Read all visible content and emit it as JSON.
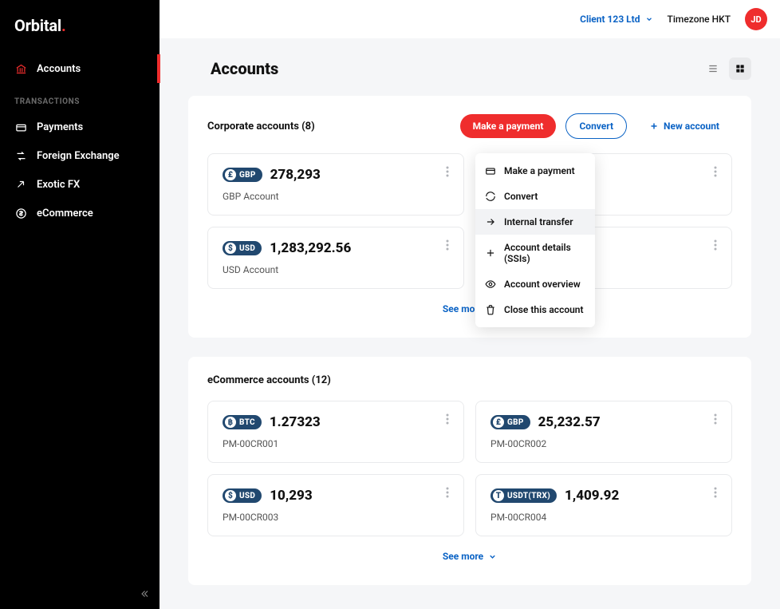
{
  "brand": {
    "name": "Orbital"
  },
  "sidebar": {
    "nav": {
      "accounts": "Accounts"
    },
    "section_label": "TRANSACTIONS",
    "tx": {
      "payments": "Payments",
      "fx": "Foreign Exchange",
      "exotic": "Exotic FX",
      "ecom": "eCommerce"
    }
  },
  "topbar": {
    "client": "Client 123 Ltd",
    "timezone": "Timezone HKT",
    "avatar": "JD"
  },
  "page": {
    "title": "Accounts"
  },
  "corporate": {
    "title": "Corporate accounts (8)",
    "actions": {
      "pay": "Make a payment",
      "convert": "Convert",
      "new": "New account"
    },
    "cards": [
      {
        "chip_letter": "£",
        "chip_label": "GBP",
        "balance": "278,293",
        "sub": "GBP Account"
      },
      {
        "chip_letter": "$",
        "chip_label": "USD",
        "balance": "1,283,292.56",
        "sub": "USD Account"
      }
    ],
    "see_more": "See more"
  },
  "ecommerce": {
    "title": "eCommerce accounts (12)",
    "cards": [
      {
        "chip_letter": "฿",
        "chip_label": "BTC",
        "balance": "1.27323",
        "sub": "PM-00CR001"
      },
      {
        "chip_letter": "£",
        "chip_label": "GBP",
        "balance": "25,232.57",
        "sub": "PM-00CR002"
      },
      {
        "chip_letter": "$",
        "chip_label": "USD",
        "balance": "10,293",
        "sub": "PM-00CR003"
      },
      {
        "chip_letter": "T",
        "chip_label": "USDT(TRX)",
        "balance": "1,409.92",
        "sub": "PM-00CR004"
      }
    ],
    "see_more": "See more"
  },
  "menu": {
    "pay": "Make a payment",
    "convert": "Convert",
    "transfer": "Internal transfer",
    "details": "Account details (SSIs)",
    "overview": "Account overview",
    "close": "Close this account"
  }
}
